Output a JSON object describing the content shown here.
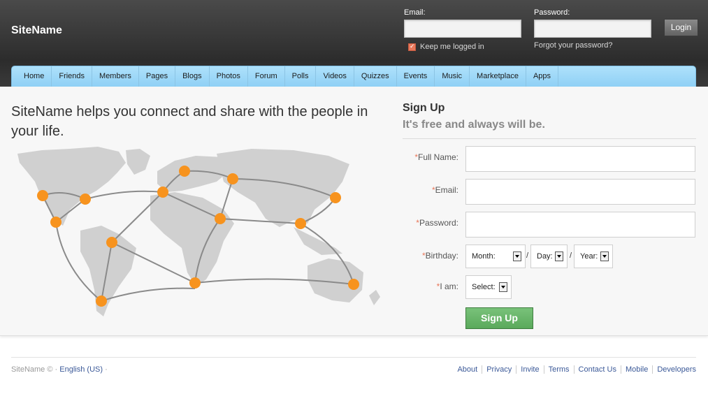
{
  "header": {
    "site_name": "SiteName",
    "email_label": "Email:",
    "password_label": "Password:",
    "login_button": "Login",
    "keep_logged_in": "Keep me logged in",
    "forgot_password": "Forgot your password?"
  },
  "nav": {
    "items": [
      "Home",
      "Friends",
      "Members",
      "Pages",
      "Blogs",
      "Photos",
      "Forum",
      "Polls",
      "Videos",
      "Quizzes",
      "Events",
      "Music",
      "Marketplace",
      "Apps"
    ]
  },
  "main": {
    "tagline": "SiteName helps you connect and share with the people in your life."
  },
  "signup": {
    "title": "Sign Up",
    "subtitle": "It's free and always will be.",
    "required_mark": "*",
    "full_name_label": "Full Name:",
    "email_label": "Email:",
    "password_label": "Password:",
    "birthday_label": "Birthday:",
    "i_am_label": "I am:",
    "month": "Month:",
    "day": "Day:",
    "year": "Year:",
    "slash": "/",
    "gender": "Select:",
    "button": "Sign Up"
  },
  "footer": {
    "site": "SiteName ©",
    "separator": "·",
    "language": "English (US)",
    "links": [
      "About",
      "Privacy",
      "Invite",
      "Terms",
      "Contact Us",
      "Mobile",
      "Developers"
    ]
  },
  "colors": {
    "accent_orange": "#f7931e",
    "nav_blue": "#9fd8f8",
    "signup_green": "#6ab86b",
    "link_blue": "#3b5998"
  }
}
